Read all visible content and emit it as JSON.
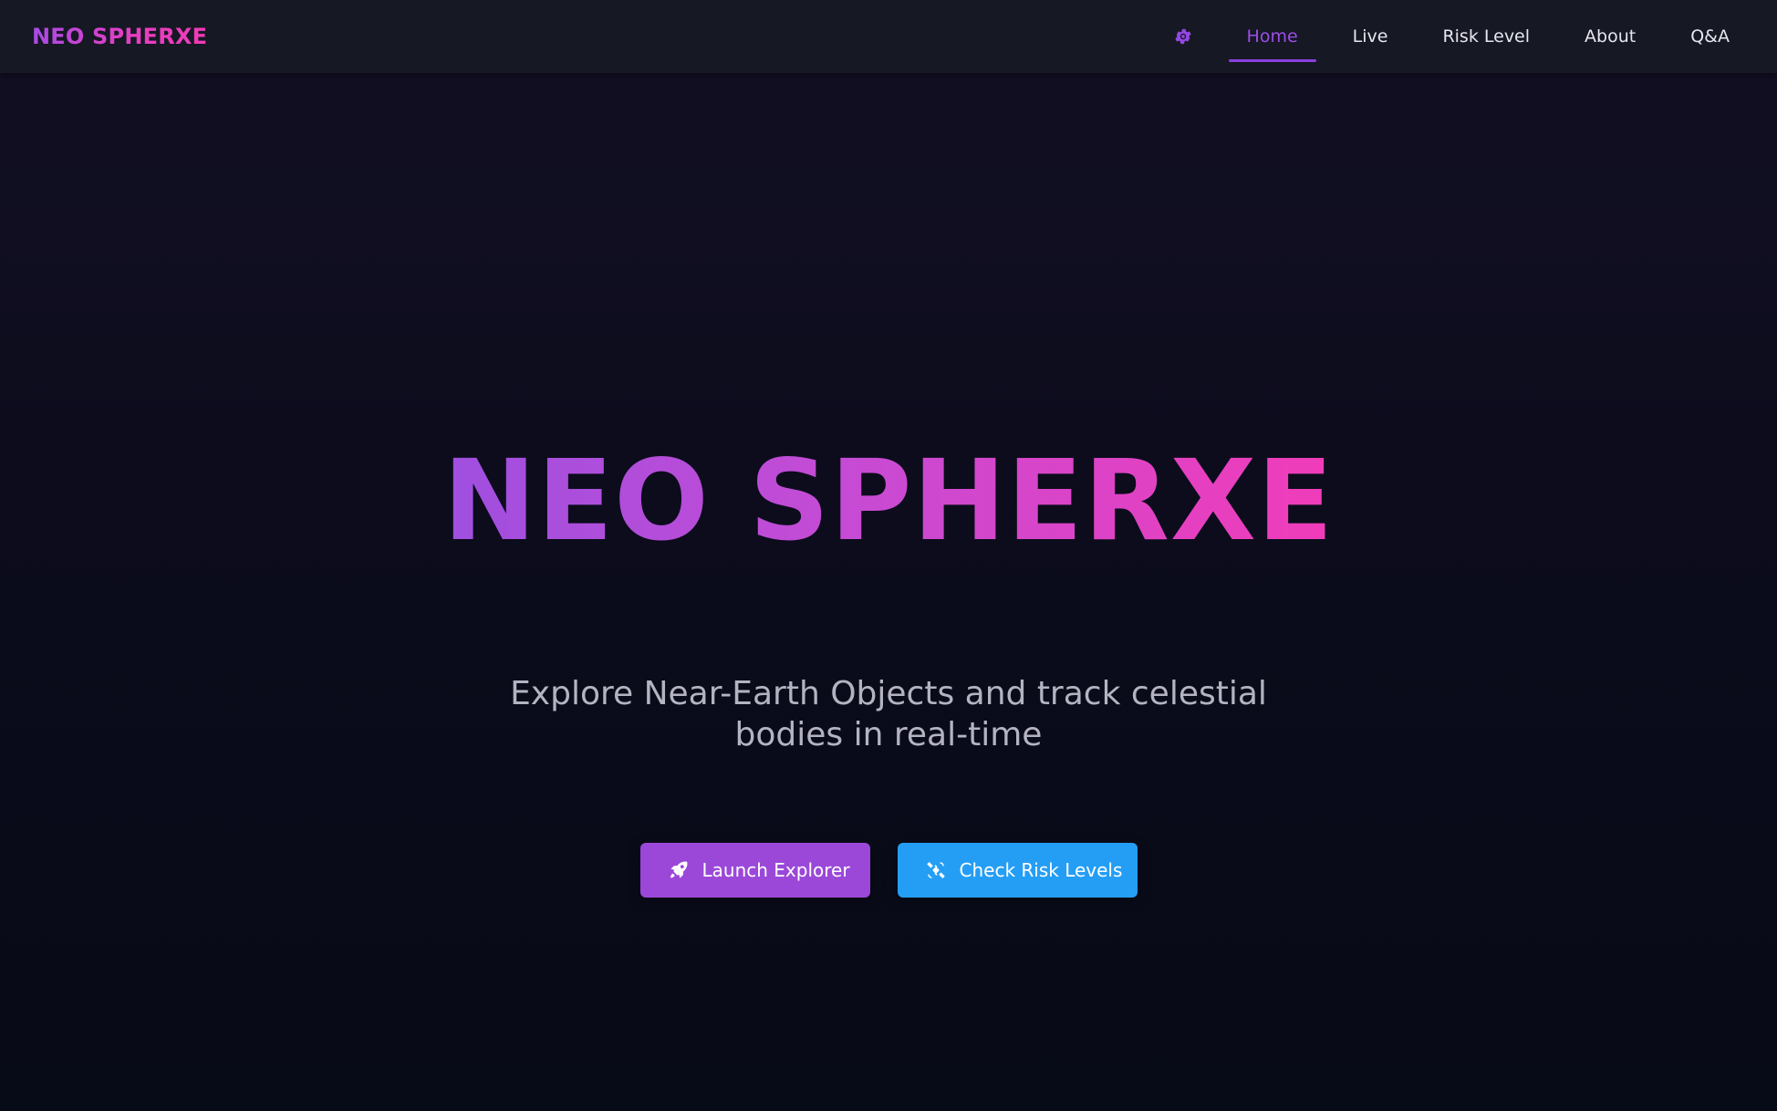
{
  "brand": {
    "name": "NEO SPHERXE"
  },
  "nav": {
    "theme_toggle_icon": "gear-icon",
    "items": [
      {
        "label": "Home",
        "active": true
      },
      {
        "label": "Live",
        "active": false
      },
      {
        "label": "Risk Level",
        "active": false
      },
      {
        "label": "About",
        "active": false
      },
      {
        "label": "Q&A",
        "active": false
      }
    ]
  },
  "hero": {
    "title": "NEO SPHERXE",
    "subtitle": "Explore Near-Earth Objects and track celestial bodies in real-time",
    "buttons": {
      "launch": {
        "label": "Launch Explorer",
        "icon": "rocket-icon"
      },
      "risk": {
        "label": "Check Risk Levels",
        "icon": "satellite-icon"
      }
    }
  },
  "colors": {
    "accent_purple": "#9b48d9",
    "accent_pink": "#f13cb9",
    "accent_blue": "#249ef5",
    "nav_background": "#161824",
    "page_background": "#0c0c1c"
  }
}
